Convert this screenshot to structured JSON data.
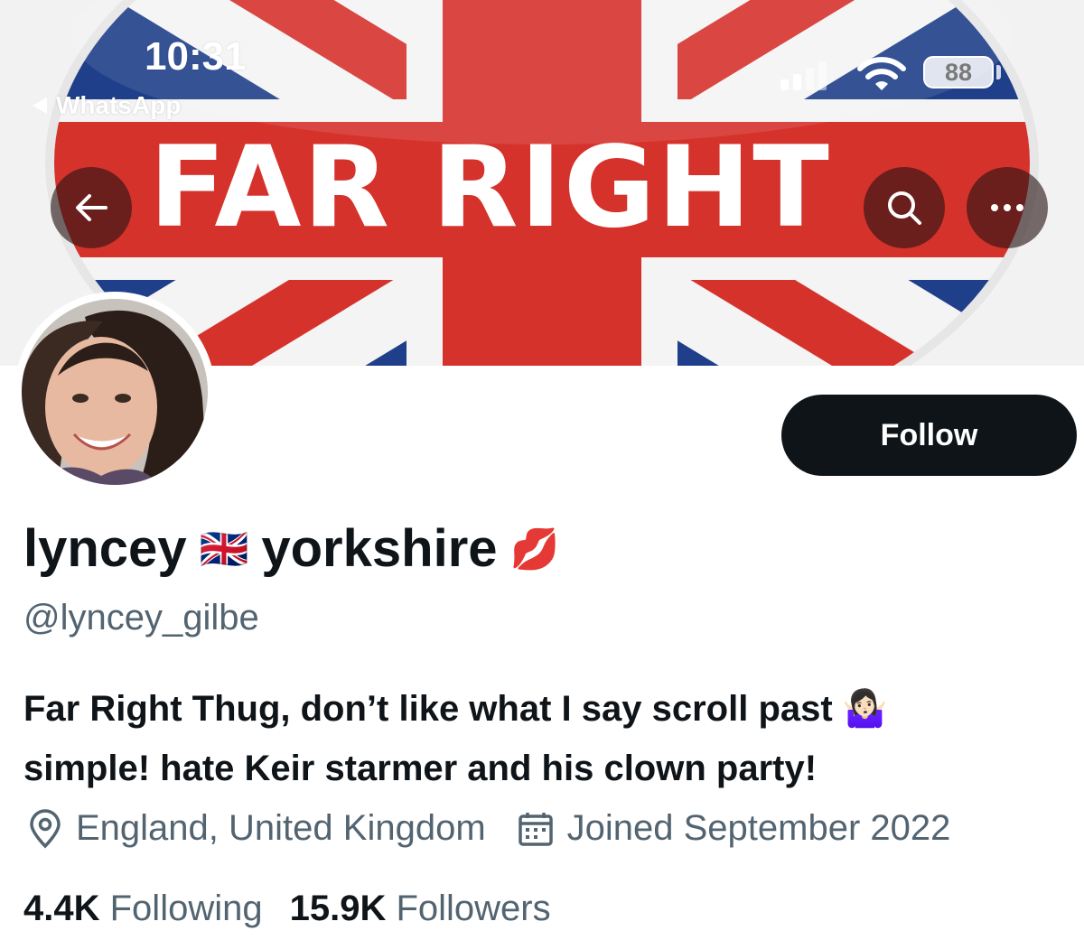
{
  "status_bar": {
    "time": "10:31",
    "back_app": "WhatsApp",
    "battery": "88"
  },
  "banner": {
    "text": "FAR RIGHT",
    "colors": {
      "red": "#d6322c",
      "blue": "#1f3f8a",
      "white": "#f4f4f4"
    }
  },
  "header_actions": {
    "back_icon": "arrow-left-icon",
    "search_icon": "search-icon",
    "more_icon": "more-icon"
  },
  "profile": {
    "follow_label": "Follow",
    "display_name_first": "lyncey",
    "flag_emoji": "🇬🇧",
    "display_name_second": "yorkshire",
    "lips_emoji": "💋",
    "handle": "@lyncey_gilbe",
    "bio_line1": "Far Right Thug, don’t like what I say scroll past 🤷🏻‍♀️",
    "bio_line2": "simple! hate Keir starmer and his clown party!",
    "location": "England, United Kingdom",
    "joined": "Joined September 2022",
    "following_count": "4.4K",
    "following_label": "Following",
    "followers_count": "15.9K",
    "followers_label": "Followers"
  }
}
